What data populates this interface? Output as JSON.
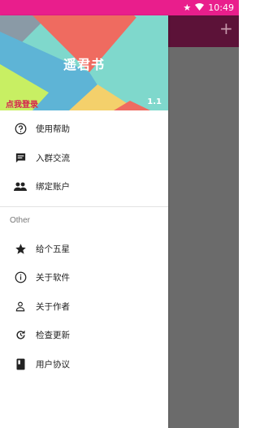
{
  "status_bar": {
    "time": "10:49",
    "star_icon": "star-icon",
    "wifi_icon": "wifi-icon"
  },
  "drawer": {
    "app_title": "遥君书",
    "login_text": "点我登录",
    "version": "1.1",
    "section_other": "Other",
    "items_main": [
      {
        "icon": "help-icon",
        "label": "使用帮助"
      },
      {
        "icon": "chat-icon",
        "label": "入群交流"
      },
      {
        "icon": "people-icon",
        "label": "绑定账户"
      }
    ],
    "items_other": [
      {
        "icon": "star-icon",
        "label": "给个五星"
      },
      {
        "icon": "info-icon",
        "label": "关于软件"
      },
      {
        "icon": "person-icon",
        "label": "关于作者"
      },
      {
        "icon": "refresh-icon",
        "label": "检查更新"
      },
      {
        "icon": "book-icon",
        "label": "用户协议"
      }
    ]
  },
  "main_toolbar": {
    "add_label": "+"
  },
  "colors": {
    "status": "#e91e8c",
    "toolbar": "#5c1238",
    "login": "#d6204e"
  }
}
